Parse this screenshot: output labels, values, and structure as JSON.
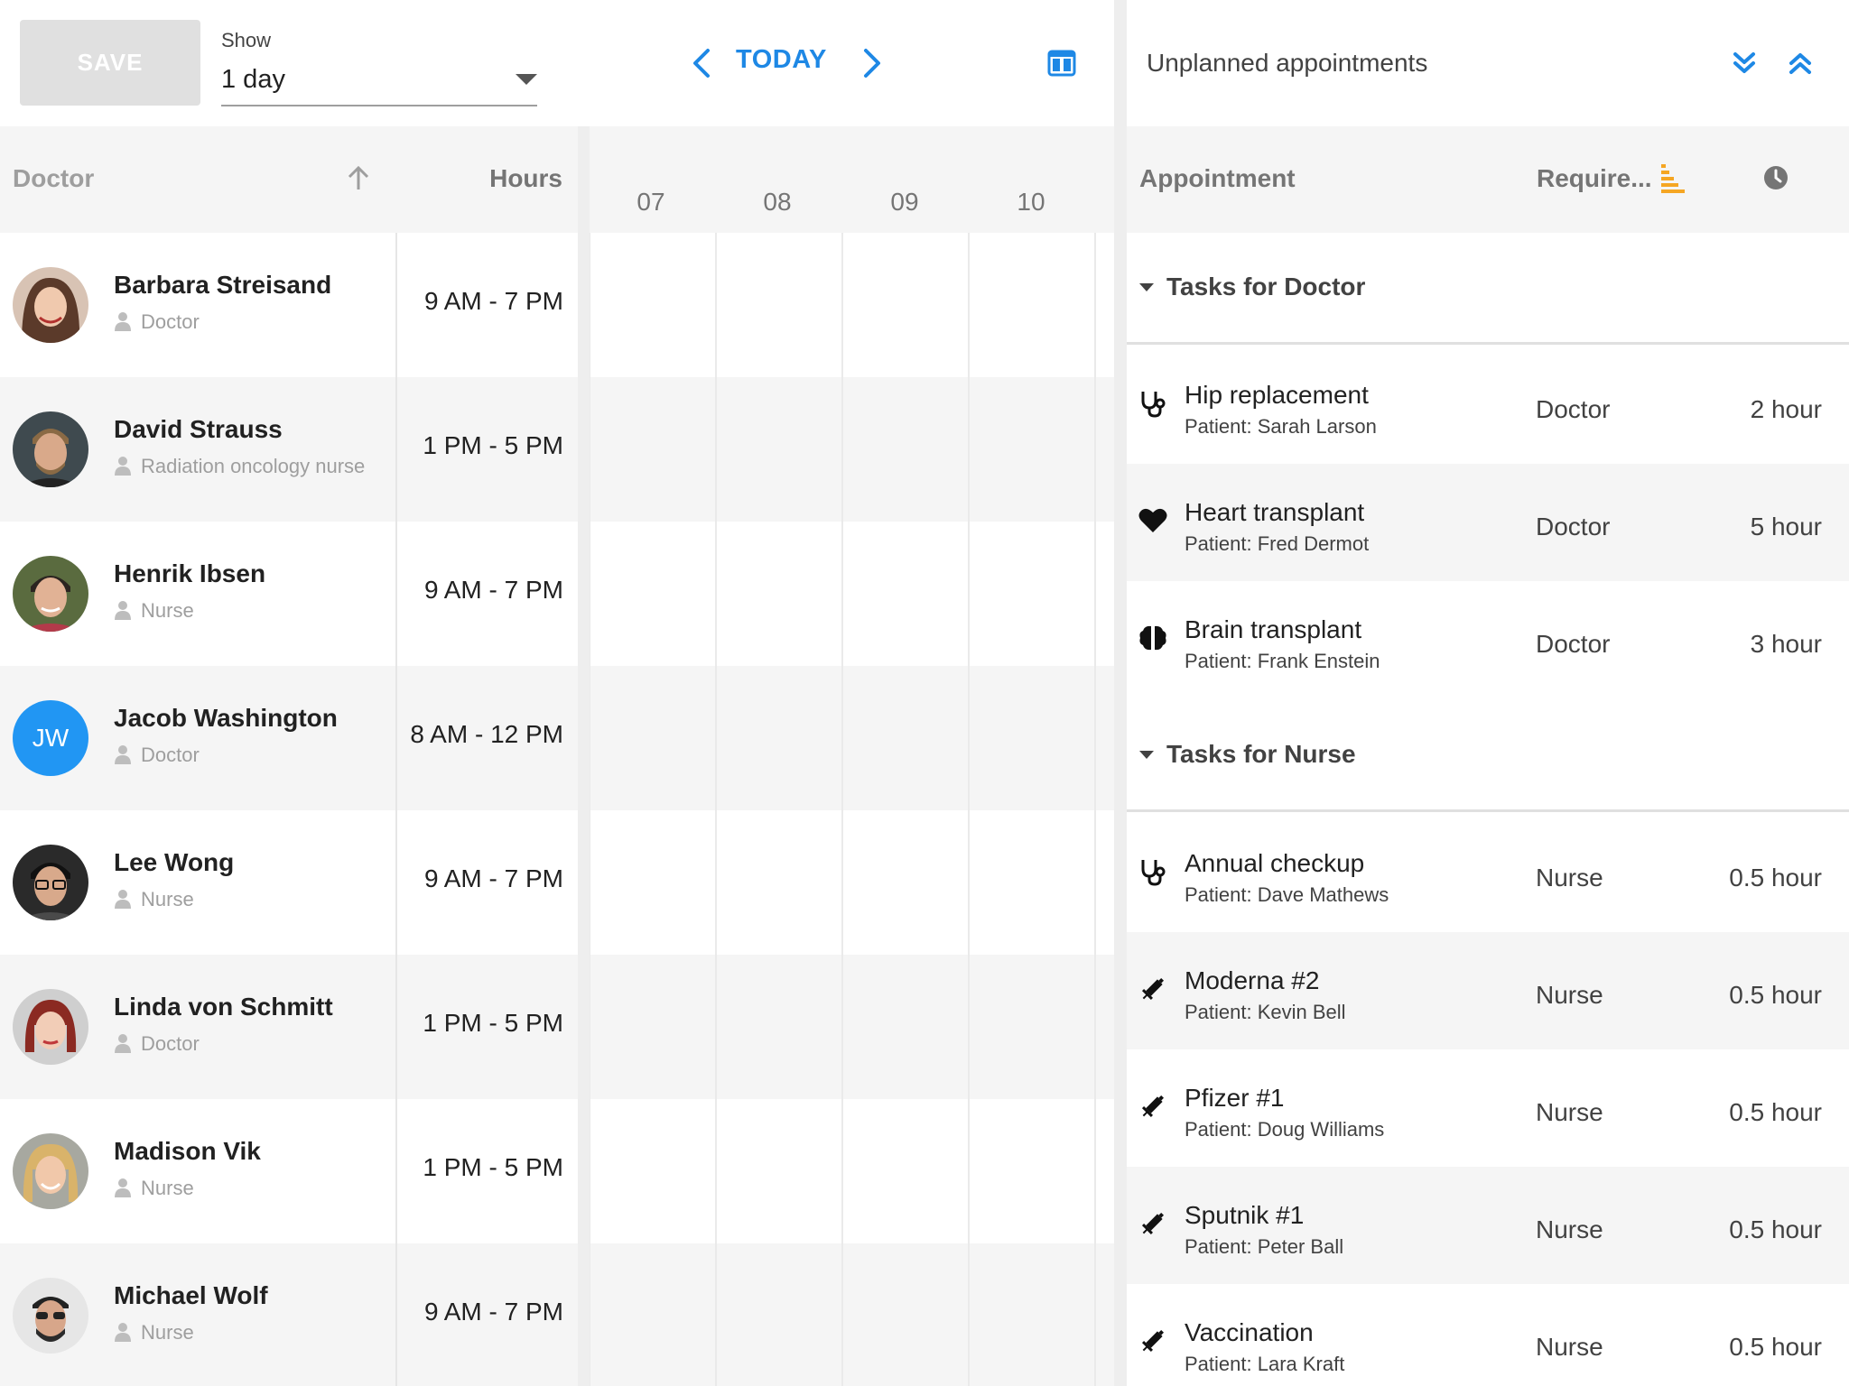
{
  "toolbar": {
    "save_label": "SAVE",
    "show_label": "Show",
    "show_value": "1 day",
    "today_label": "TODAY"
  },
  "grid_header": {
    "doctor_label": "Doctor",
    "hours_label": "Hours",
    "time_ticks": [
      "07",
      "08",
      "09",
      "10"
    ]
  },
  "resources": [
    {
      "name": "Barbara Streisand",
      "role": "Doctor",
      "hours": "9 AM - 7 PM",
      "avatar": "photo"
    },
    {
      "name": "David Strauss",
      "role": "Radiation oncology nurse",
      "hours": "1 PM - 5 PM",
      "avatar": "photo"
    },
    {
      "name": "Henrik Ibsen",
      "role": "Nurse",
      "hours": "9 AM - 7 PM",
      "avatar": "photo"
    },
    {
      "name": "Jacob Washington",
      "role": "Doctor",
      "hours": "8 AM - 12 PM",
      "avatar": "initials",
      "initials": "JW"
    },
    {
      "name": "Lee Wong",
      "role": "Nurse",
      "hours": "9 AM - 7 PM",
      "avatar": "photo"
    },
    {
      "name": "Linda von Schmitt",
      "role": "Doctor",
      "hours": "1 PM - 5 PM",
      "avatar": "photo"
    },
    {
      "name": "Madison Vik",
      "role": "Nurse",
      "hours": "1 PM - 5 PM",
      "avatar": "photo"
    },
    {
      "name": "Michael Wolf",
      "role": "Nurse",
      "hours": "9 AM - 7 PM",
      "avatar": "photo"
    }
  ],
  "panel": {
    "title": "Unplanned appointments",
    "header": {
      "appointment_label": "Appointment",
      "required_label": "Require..."
    },
    "groups": [
      {
        "label": "Tasks for Doctor",
        "tasks": [
          {
            "title": "Hip replacement",
            "patient": "Patient: Sarah Larson",
            "required": "Doctor",
            "duration": "2 hour",
            "icon": "stethoscope-icon"
          },
          {
            "title": "Heart transplant",
            "patient": "Patient: Fred Dermot",
            "required": "Doctor",
            "duration": "5 hour",
            "icon": "heart-icon"
          },
          {
            "title": "Brain transplant",
            "patient": "Patient: Frank Enstein",
            "required": "Doctor",
            "duration": "3 hour",
            "icon": "brain-icon"
          }
        ]
      },
      {
        "label": "Tasks for Nurse",
        "tasks": [
          {
            "title": "Annual checkup",
            "patient": "Patient: Dave Mathews",
            "required": "Nurse",
            "duration": "0.5 hour",
            "icon": "stethoscope-icon"
          },
          {
            "title": "Moderna #2",
            "patient": "Patient: Kevin Bell",
            "required": "Nurse",
            "duration": "0.5 hour",
            "icon": "syringe-icon"
          },
          {
            "title": "Pfizer #1",
            "patient": "Patient: Doug Williams",
            "required": "Nurse",
            "duration": "0.5 hour",
            "icon": "syringe-icon"
          },
          {
            "title": "Sputnik #1",
            "patient": "Patient: Peter Ball",
            "required": "Nurse",
            "duration": "0.5 hour",
            "icon": "syringe-icon"
          },
          {
            "title": "Vaccination",
            "patient": "Patient: Lara Kraft",
            "required": "Nurse",
            "duration": "0.5 hour",
            "icon": "syringe-icon"
          }
        ]
      }
    ]
  },
  "colors": {
    "accent": "#1e88e5",
    "sort_icon": "#f5a623",
    "avatar_initials_bg": "#2196f3"
  }
}
